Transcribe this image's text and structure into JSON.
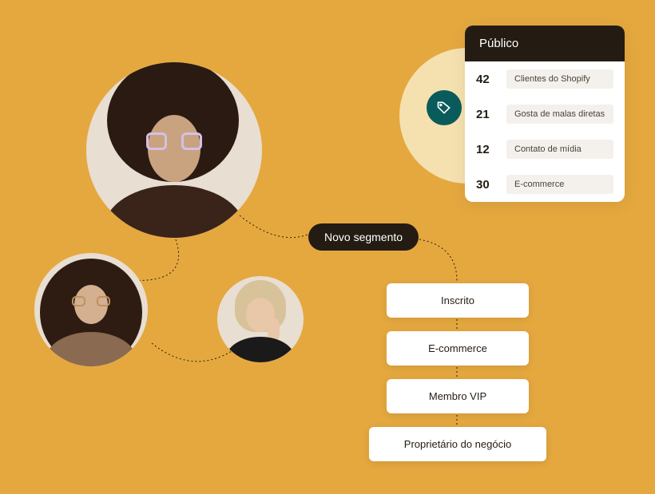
{
  "segment_pill": "Novo segmento",
  "audience_card": {
    "title": "Público",
    "rows": [
      {
        "count": "42",
        "label": "Clientes do Shopify"
      },
      {
        "count": "21",
        "label": "Gosta de malas diretas"
      },
      {
        "count": "12",
        "label": "Contato de mídia"
      },
      {
        "count": "30",
        "label": "E-commerce"
      }
    ]
  },
  "segment_chips": [
    "Inscrito",
    "E-commerce",
    "Membro VIP",
    "Proprietário do negócio"
  ]
}
